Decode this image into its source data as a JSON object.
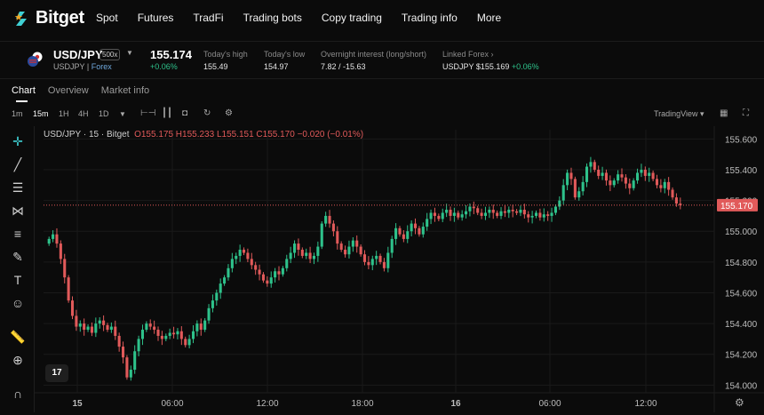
{
  "brand": {
    "name": "Bitget"
  },
  "nav": [
    "Spot",
    "Futures",
    "TradFi",
    "Trading bots",
    "Copy trading",
    "Trading info",
    "More"
  ],
  "ticker": {
    "pair": "USD/JPY",
    "leverage": "500x",
    "symbol": "USDJPY",
    "market": "Forex",
    "last_price": "155.174",
    "change": "+0.06%",
    "stats": [
      {
        "label": "Today's high",
        "value": "155.49"
      },
      {
        "label": "Today's low",
        "value": "154.97"
      },
      {
        "label": "Overnight interest (long/short)",
        "value": "7.82 / -15.63"
      }
    ],
    "linked": {
      "label": "Linked Forex",
      "symbol": "USDJPY $155.169",
      "change": "+0.06%"
    }
  },
  "tabs": [
    "Chart",
    "Overview",
    "Market info"
  ],
  "timeframes": [
    "1m",
    "15m",
    "1H",
    "4H",
    "1D"
  ],
  "active_timeframe": "15m",
  "tradingview_label": "TradingView",
  "chart_header": {
    "title": "USD/JPY · 15 · Bitget",
    "ohlc": "O155.175 H155.233 L155.151 C155.170 −0.020 (−0.01%)"
  },
  "tv_badge": "17",
  "colors": {
    "up": "#2ec28b",
    "down": "#e15a5a",
    "background": "#0b0b0b",
    "grid": "#1a1a1a",
    "accent_star": "#f5a623"
  },
  "chart_data": {
    "type": "candlestick",
    "y_ticks": [
      "155.600",
      "155.400",
      "155.200",
      "155.000",
      "154.800",
      "154.600",
      "154.400",
      "154.200",
      "154.000"
    ],
    "x_ticks": [
      "15",
      "06:00",
      "12:00",
      "18:00",
      "16",
      "06:00",
      "12:00"
    ],
    "last_price_label": "155.170",
    "ylim": [
      153.95,
      155.66
    ],
    "interval": "15m",
    "candles_close": [
      154.95,
      154.98,
      154.92,
      154.82,
      154.7,
      154.55,
      154.45,
      154.38,
      154.4,
      154.36,
      154.38,
      154.34,
      154.4,
      154.42,
      154.39,
      154.36,
      154.38,
      154.32,
      154.25,
      154.18,
      154.05,
      154.1,
      154.22,
      154.3,
      154.36,
      154.4,
      154.38,
      154.36,
      154.32,
      154.3,
      154.32,
      154.34,
      154.33,
      154.35,
      154.3,
      154.26,
      154.3,
      154.35,
      154.4,
      154.36,
      154.42,
      154.5,
      154.55,
      154.6,
      154.66,
      154.7,
      154.76,
      154.82,
      154.84,
      154.88,
      154.86,
      154.82,
      154.78,
      154.75,
      154.72,
      154.68,
      154.66,
      154.7,
      154.74,
      154.72,
      154.76,
      154.82,
      154.86,
      154.92,
      154.88,
      154.84,
      154.86,
      154.82,
      154.84,
      154.9,
      155.05,
      155.1,
      155.05,
      155.0,
      154.92,
      154.88,
      154.85,
      154.9,
      154.94,
      154.9,
      154.85,
      154.8,
      154.78,
      154.82,
      154.84,
      154.8,
      154.76,
      154.86,
      154.95,
      155.02,
      154.98,
      154.95,
      155.0,
      155.05,
      155.02,
      154.98,
      155.03,
      155.08,
      155.12,
      155.1,
      155.08,
      155.12,
      155.14,
      155.1,
      155.12,
      155.09,
      155.11,
      155.13,
      155.16,
      155.15,
      155.12,
      155.1,
      155.12,
      155.14,
      155.12,
      155.1,
      155.13,
      155.12,
      155.14,
      155.13,
      155.12,
      155.14,
      155.11,
      155.09,
      155.1,
      155.12,
      155.09,
      155.11,
      155.1,
      155.12,
      155.16,
      155.2,
      155.3,
      155.38,
      155.34,
      155.22,
      155.26,
      155.32,
      155.42,
      155.45,
      155.4,
      155.36,
      155.38,
      155.33,
      155.3,
      155.33,
      155.37,
      155.35,
      155.31,
      155.28,
      155.33,
      155.38,
      155.4,
      155.36,
      155.38,
      155.34,
      155.3,
      155.28,
      155.32,
      155.27,
      155.22,
      155.18,
      155.17
    ]
  }
}
